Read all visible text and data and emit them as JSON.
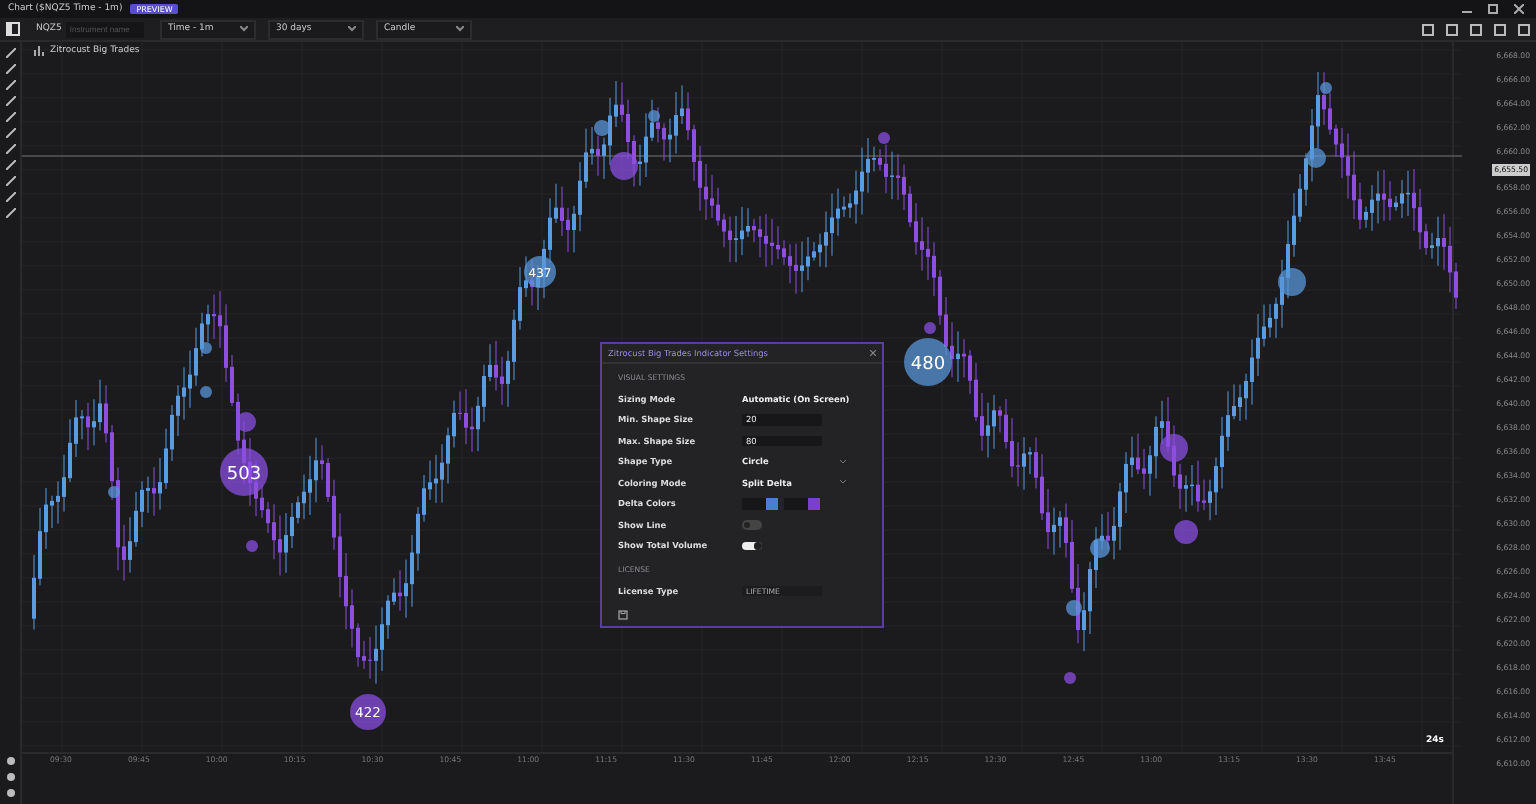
{
  "window": {
    "title": "Chart ($NQZ5 Time - 1m)",
    "badge": "PREVIEW"
  },
  "toolbar": {
    "symbol": "NQZ5",
    "placeholder": "Instrument name",
    "dropdowns": [
      "Time - 1m",
      "30 days",
      "Candle"
    ]
  },
  "indicator_label": "Zitrocust Big Trades",
  "bubbles": [
    "503",
    "480",
    "422",
    "437"
  ],
  "price_axis": {
    "labels": [
      "6,668.00",
      "6,666.00",
      "6,664.00",
      "6,662.00",
      "6,660.00",
      "6,658.00",
      "6,656.00",
      "6,654.00",
      "6,652.00",
      "6,650.00",
      "6,648.00",
      "6,646.00",
      "6,644.00",
      "6,642.00",
      "6,640.00",
      "6,638.00",
      "6,636.00",
      "6,634.00",
      "6,632.00",
      "6,630.00",
      "6,628.00",
      "6,626.00",
      "6,624.00",
      "6,622.00",
      "6,620.00",
      "6,618.00",
      "6,616.00",
      "6,614.00",
      "6,612.00",
      "6,610.00"
    ],
    "current": "6,655.50"
  },
  "time_axis": [
    "09:30",
    "09:45",
    "10:00",
    "10:15",
    "10:30",
    "10:45",
    "11:00",
    "11:15",
    "11:30",
    "11:45",
    "12:00",
    "12:15",
    "12:30",
    "12:45",
    "13:00",
    "13:15",
    "13:30",
    "13:45"
  ],
  "zoom_label": "24s",
  "dialog": {
    "title": "Zitrocust Big Trades Indicator Settings",
    "sections": [
      {
        "heading": "VISUAL SETTINGS",
        "rows": [
          {
            "kind": "select",
            "label": "Sizing Mode",
            "value": "Automatic (On Screen)"
          },
          {
            "kind": "number",
            "label": "Min. Shape Size",
            "value": "20"
          },
          {
            "kind": "number",
            "label": "Max. Shape Size",
            "value": "80"
          },
          {
            "kind": "select",
            "label": "Shape Type",
            "value": "Circle"
          },
          {
            "kind": "select",
            "label": "Coloring Mode",
            "value": "Split Delta"
          },
          {
            "kind": "colors",
            "label": "Delta Colors",
            "colors": [
              {
                "color": "#4a7fd0"
              },
              {
                "color": "#7b3fd0"
              }
            ]
          },
          {
            "kind": "toggle",
            "label": "Show Line",
            "on": false
          },
          {
            "kind": "toggle",
            "label": "Show Total Volume",
            "on": true
          }
        ]
      },
      {
        "heading": "LICENSE",
        "rows": [
          {
            "kind": "text",
            "label": "License Type",
            "value": "LIFETIME"
          }
        ]
      }
    ]
  }
}
